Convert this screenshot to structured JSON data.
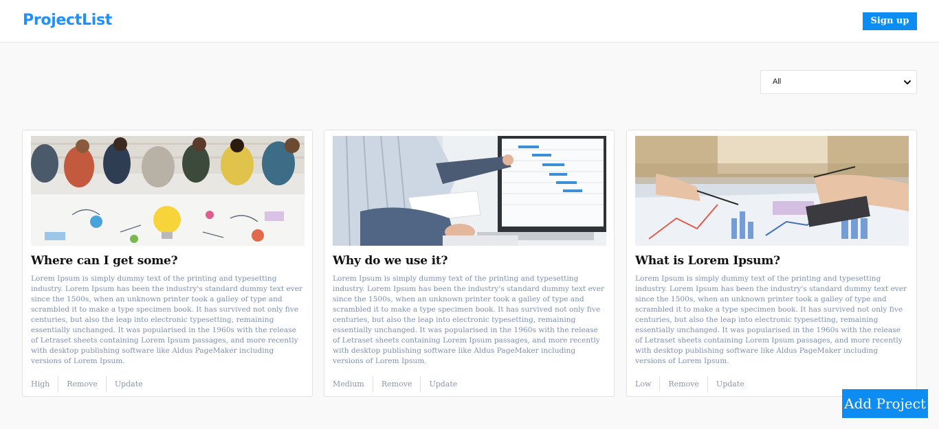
{
  "header": {
    "logo": "ProjectList",
    "signup_label": "Sign up"
  },
  "filter": {
    "selected": "All"
  },
  "cards": [
    {
      "title": "Where can I get some?",
      "description": "Lorem Ipsum is simply dummy text of the printing and typesetting industry. Lorem Ipsum has been the industry's standard dummy text ever since the 1500s, when an unknown printer took a galley of type and scrambled it to make a type specimen book. It has survived not only five centuries, but also the leap into electronic typesetting, remaining essentially unchanged. It was popularised in the 1960s with the release of Letraset sheets containing Lorem Ipsum passages, and more recently with desktop publishing software like Aldus PageMaker including versions of Lorem Ipsum.",
      "priority": "High",
      "remove_label": "Remove",
      "update_label": "Update",
      "image": "team-brainstorm-photo"
    },
    {
      "title": "Why do we use it?",
      "description": "Lorem Ipsum is simply dummy text of the printing and typesetting industry. Lorem Ipsum has been the industry's standard dummy text ever since the 1500s, when an unknown printer took a galley of type and scrambled it to make a type specimen book. It has survived not only five centuries, but also the leap into electronic typesetting, remaining essentially unchanged. It was popularised in the 1960s with the release of Letraset sheets containing Lorem Ipsum passages, and more recently with desktop publishing software like Aldus PageMaker including versions of Lorem Ipsum.",
      "priority": "Medium",
      "remove_label": "Remove",
      "update_label": "Update",
      "image": "gantt-chart-monitor-photo"
    },
    {
      "title": "What is Lorem Ipsum?",
      "description": "Lorem Ipsum is simply dummy text of the printing and typesetting industry. Lorem Ipsum has been the industry's standard dummy text ever since the 1500s, when an unknown printer took a galley of type and scrambled it to make a type specimen book. It has survived not only five centuries, but also the leap into electronic typesetting, remaining essentially unchanged. It was popularised in the 1960s with the release of Letraset sheets containing Lorem Ipsum passages, and more recently with desktop publishing software like Aldus PageMaker including versions of Lorem Ipsum.",
      "priority": "Low",
      "remove_label": "Remove",
      "update_label": "Update",
      "image": "charts-paperwork-photo"
    }
  ],
  "add_project_label": "Add Project",
  "colors": {
    "accent": "#0d8df2",
    "logo": "#1e90ff",
    "description_text": "#7d8fb0"
  }
}
